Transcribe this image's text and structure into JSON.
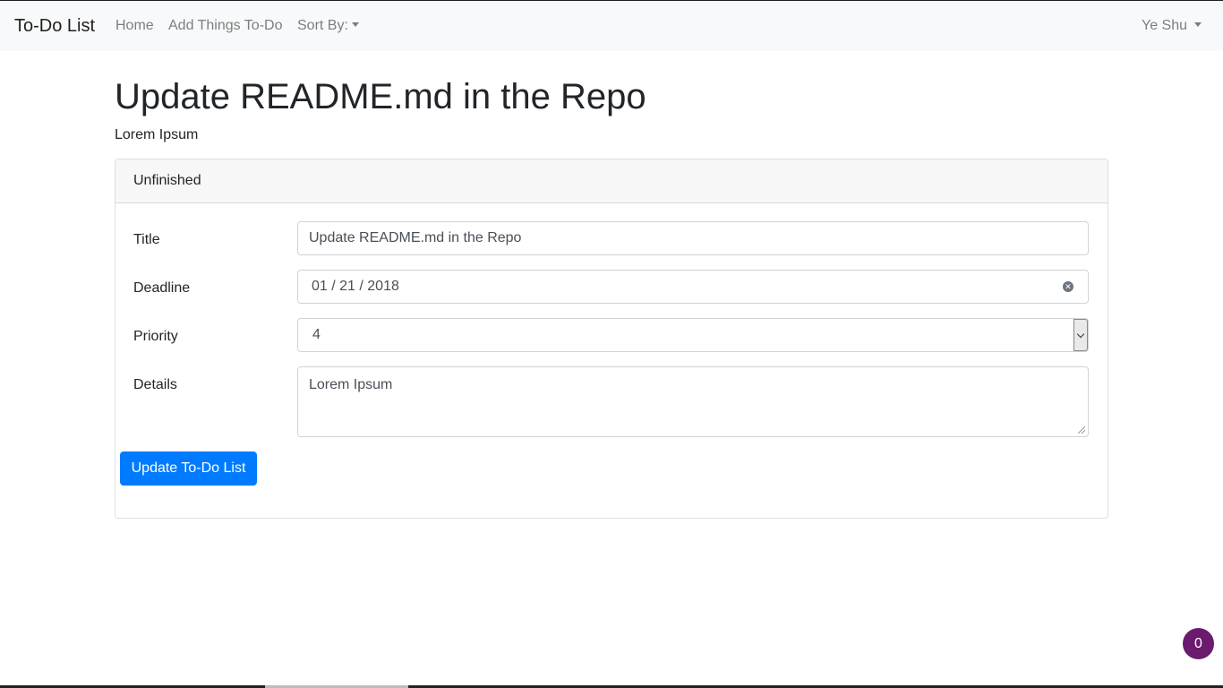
{
  "navbar": {
    "brand": "To-Do List",
    "links": {
      "home": "Home",
      "add": "Add Things To-Do",
      "sort": "Sort By:"
    },
    "user": "Ye Shu"
  },
  "page": {
    "title": "Update README.md in the Repo",
    "subtitle": "Lorem Ipsum"
  },
  "card": {
    "header": "Unfinished",
    "fields": {
      "title_label": "Title",
      "title_value": "Update README.md in the Repo",
      "deadline_label": "Deadline",
      "deadline_value": "01 / 21 / 2018",
      "priority_label": "Priority",
      "priority_value": "4",
      "details_label": "Details",
      "details_value": "Lorem Ipsum"
    },
    "submit_label": "Update To-Do List"
  },
  "badge": {
    "count": "0"
  },
  "colors": {
    "primary": "#007bff",
    "navbar_bg": "#f8f9fa",
    "badge_bg": "#6a1b6e"
  },
  "icons": {
    "clear": "clear-icon",
    "dropdown": "chevron-down-icon",
    "caret": "caret-down-icon"
  }
}
